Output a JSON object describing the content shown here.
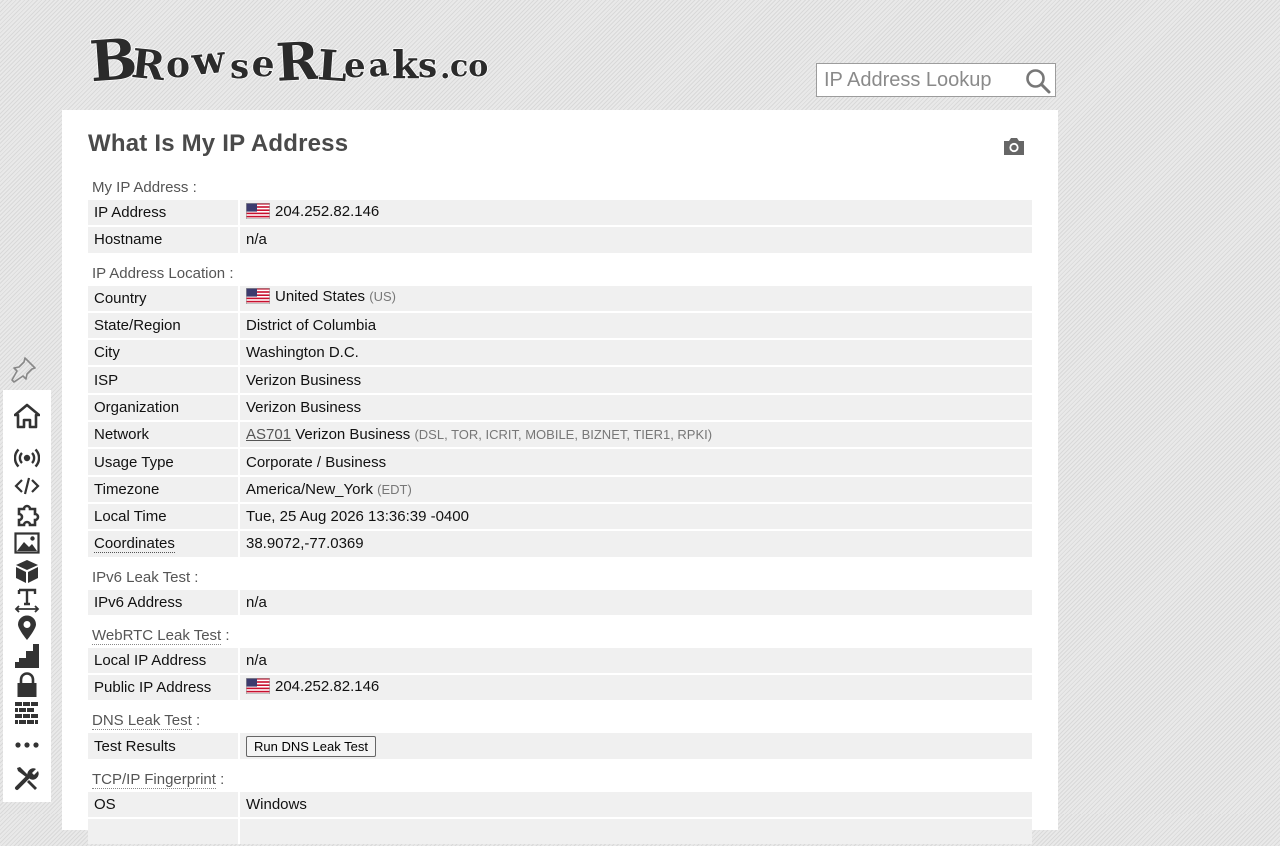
{
  "header": {
    "logo_text": "BrowserLeaks.com",
    "search_placeholder": "IP Address Lookup"
  },
  "page": {
    "title": "What Is My IP Address"
  },
  "sections": {
    "my_ip": "My IP Address :",
    "location": "IP Address Location :",
    "ipv6": "IPv6 Leak Test :",
    "webrtc": "WebRTC Leak Test",
    "dns": "DNS Leak Test",
    "tcpip": "TCP/IP Fingerprint",
    "colon": " :"
  },
  "rows": {
    "ip_address": {
      "label": "IP Address",
      "value": "204.252.82.146"
    },
    "hostname": {
      "label": "Hostname",
      "value": "n/a"
    },
    "country": {
      "label": "Country",
      "value": "United States",
      "code": "(US)"
    },
    "state": {
      "label": "State/Region",
      "value": "District of Columbia"
    },
    "city": {
      "label": "City",
      "value": "Washington D.C."
    },
    "isp": {
      "label": "ISP",
      "value": "Verizon Business"
    },
    "organization": {
      "label": "Organization",
      "value": "Verizon Business"
    },
    "network": {
      "label": "Network",
      "asn": "AS701",
      "value": "Verizon Business",
      "tags": "(DSL, TOR, ICRIT, MOBILE, BIZNET, TIER1, RPKI)"
    },
    "usage_type": {
      "label": "Usage Type",
      "value": "Corporate / Business"
    },
    "timezone": {
      "label": "Timezone",
      "value": "America/New_York",
      "abbr": "(EDT)"
    },
    "local_time": {
      "label": "Local Time",
      "value": "Tue, 25 Aug 2026 13:36:39 -0400"
    },
    "coordinates": {
      "label": "Coordinates",
      "value": "38.9072,-77.0369"
    },
    "ipv6_address": {
      "label": "IPv6 Address",
      "value": "n/a"
    },
    "local_ip": {
      "label": "Local IP Address",
      "value": "n/a"
    },
    "public_ip": {
      "label": "Public IP Address",
      "value": "204.252.82.146"
    },
    "test_results": {
      "label": "Test Results",
      "button": "Run DNS Leak Test"
    },
    "os": {
      "label": "OS",
      "value": "Windows"
    }
  },
  "icons": {
    "search": "search-icon",
    "camera": "camera-icon",
    "pin": "pin-icon",
    "sidebar": [
      "home-icon",
      "broadcast-icon",
      "code-icon",
      "puzzle-icon",
      "image-icon",
      "cube-icon",
      "text-height-icon",
      "map-marker-icon",
      "signal-icon",
      "lock-icon",
      "firewall-icon",
      "more-icon",
      "tools-icon"
    ]
  },
  "colors": {
    "accent": "#333333",
    "row_bg": "#f0f0f0",
    "panel_bg": "#ffffff"
  }
}
